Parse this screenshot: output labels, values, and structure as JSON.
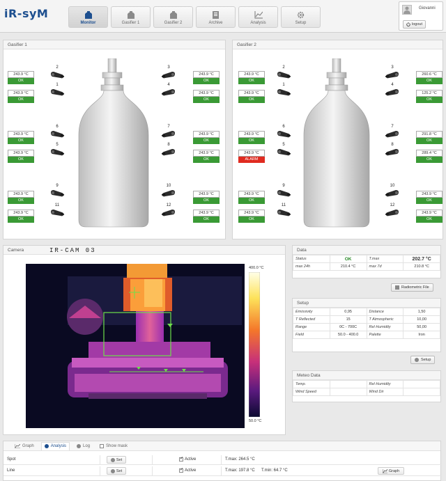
{
  "brand": "iR-syM",
  "nav": [
    {
      "label": "Monitor",
      "icon": "monitor-icon",
      "active": true
    },
    {
      "label": "Gasifier 1",
      "icon": "gasifier-icon"
    },
    {
      "label": "Gasifier 2",
      "icon": "gasifier-icon"
    },
    {
      "label": "Archive",
      "icon": "archive-icon"
    },
    {
      "label": "Analysis",
      "icon": "chart-icon"
    },
    {
      "label": "Setup",
      "icon": "gear-icon"
    }
  ],
  "user": {
    "name": "Giovanni",
    "logout": "logout"
  },
  "gasifier1": {
    "title": "Gasifier 1",
    "sensors": [
      {
        "id": "2",
        "value": "243.9 °C",
        "status": "OK"
      },
      {
        "id": "1",
        "value": "243.9 °C",
        "status": "OK"
      },
      {
        "id": "6",
        "value": "243.9 °C",
        "status": "OK"
      },
      {
        "id": "5",
        "value": "243.9 °C",
        "status": "OK"
      },
      {
        "id": "9",
        "value": "243.9 °C",
        "status": "OK"
      },
      {
        "id": "11",
        "value": "243.9 °C",
        "status": "OK"
      },
      {
        "id": "3",
        "value": "243.9 °C",
        "status": "OK"
      },
      {
        "id": "4",
        "value": "243.9 °C",
        "status": "OK"
      },
      {
        "id": "7",
        "value": "243.9 °C",
        "status": "OK"
      },
      {
        "id": "8",
        "value": "243.9 °C",
        "status": "OK"
      },
      {
        "id": "10",
        "value": "243.9 °C",
        "status": "OK"
      },
      {
        "id": "12",
        "value": "243.9 °C",
        "status": "OK"
      }
    ]
  },
  "gasifier2": {
    "title": "Gasifier 2",
    "sensors": [
      {
        "id": "2",
        "value": "243.9 °C",
        "status": "OK"
      },
      {
        "id": "1",
        "value": "243.9 °C",
        "status": "OK"
      },
      {
        "id": "6",
        "value": "243.9 °C",
        "status": "OK"
      },
      {
        "id": "5",
        "value": "243.9 °C",
        "status": "ALARM"
      },
      {
        "id": "9",
        "value": "243.9 °C",
        "status": "OK"
      },
      {
        "id": "11",
        "value": "243.9 °C",
        "status": "OK"
      },
      {
        "id": "3",
        "value": "260.6 °C",
        "status": "OK"
      },
      {
        "id": "4",
        "value": "125.2 °C",
        "status": "OK"
      },
      {
        "id": "7",
        "value": "291.8 °C",
        "status": "OK"
      },
      {
        "id": "8",
        "value": "289.4 °C",
        "status": "OK"
      },
      {
        "id": "10",
        "value": "243.9 °C",
        "status": "OK"
      },
      {
        "id": "12",
        "value": "243.9 °C",
        "status": "OK"
      }
    ]
  },
  "camera": {
    "title": "Camera",
    "name": "IR-CAM 03",
    "scale_max": "400.0 °C",
    "scale_min": "50.0 °C"
  },
  "data": {
    "title": "Data",
    "status_label": "Status",
    "status_value": "OK",
    "tmax_label": "T.max",
    "tmax_value": "202.7 °C",
    "max24_label": "max 24h",
    "max24_value": "210.4 °C",
    "max7_label": "max 7d",
    "max7_value": "210.8 °C"
  },
  "radiometric_button": "Radiometric File",
  "setup": {
    "title": "Setup",
    "rows": [
      [
        "Emissivity",
        "0,95",
        "Distance",
        "1,50"
      ],
      [
        "T Reflected",
        "15",
        "T Atmospheric",
        "10,00"
      ],
      [
        "Range",
        "0C - 700C",
        "Rel Humidity",
        "50,00"
      ],
      [
        "Field",
        "50.0 - 400.0",
        "Palette",
        "Iron"
      ]
    ],
    "button": "Setup"
  },
  "meteo": {
    "title": "Meteo Data",
    "rows": [
      [
        "Temp.",
        "",
        "Rel Humidity",
        ""
      ],
      [
        "Wind Speed",
        "",
        "Wind Dir",
        ""
      ]
    ]
  },
  "bottom": {
    "tabs": [
      "Graph",
      "Analysis",
      "Log"
    ],
    "show_mask": "Show mask",
    "set_label": "Set",
    "active_label": "Active",
    "graph_label": "Graph",
    "spot": {
      "name": "Spot",
      "tmax": "T.max: 264.5 °C"
    },
    "line": {
      "name": "Line",
      "tmax": "T.max: 197.8 °C",
      "tmin": "T.min: 64.7 °C"
    }
  },
  "colors": {
    "ok": "#3a9a35",
    "alarm": "#e02b20",
    "brand": "#1d4f8f"
  }
}
